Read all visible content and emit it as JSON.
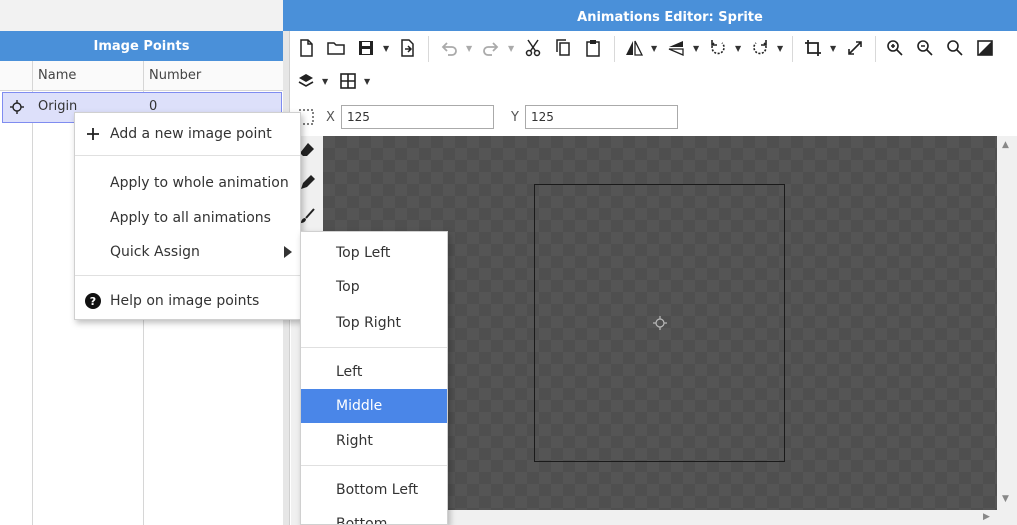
{
  "window": {
    "title": "Animations Editor: Sprite"
  },
  "image_points_panel": {
    "title": "Image Points",
    "columns": [
      "Name",
      "Number"
    ],
    "rows": [
      {
        "icon": "crosshair-icon",
        "name": "Origin",
        "number": "0",
        "selected": true
      }
    ]
  },
  "toolbar": {
    "row1": [
      "new-file-icon",
      "open-folder-icon",
      "save-icon",
      "export-icon",
      "undo-icon",
      "redo-icon",
      "cut-icon",
      "copy-icon",
      "paste-icon",
      "flip-horizontal-icon",
      "flip-vertical-icon",
      "rotate-ccw-icon",
      "rotate-cw-icon",
      "crop-icon",
      "resize-icon",
      "zoom-in-icon",
      "zoom-out-icon",
      "zoom-fit-icon",
      "background-toggle-icon"
    ],
    "row2": [
      "layers-icon",
      "grid-icon"
    ]
  },
  "coords": {
    "x_label": "X",
    "x_value": "125",
    "y_label": "Y",
    "y_value": "125"
  },
  "context_menu": {
    "items": [
      {
        "label": "Add a new image point",
        "icon": "plus-icon"
      },
      {
        "label": "Apply to whole animation"
      },
      {
        "label": "Apply to all animations"
      },
      {
        "label": "Quick Assign",
        "submenu": true
      },
      {
        "label": "Help on image points",
        "icon": "help-icon"
      }
    ]
  },
  "quick_assign_menu": {
    "items": [
      "Top Left",
      "Top",
      "Top Right",
      "Left",
      "Middle",
      "Right",
      "Bottom Left",
      "Bottom"
    ],
    "selected": "Middle"
  },
  "colors": {
    "accent": "#4a90d9",
    "selection": "#dde0fa",
    "menu_highlight": "#4a86e8",
    "canvas": "#555555"
  }
}
